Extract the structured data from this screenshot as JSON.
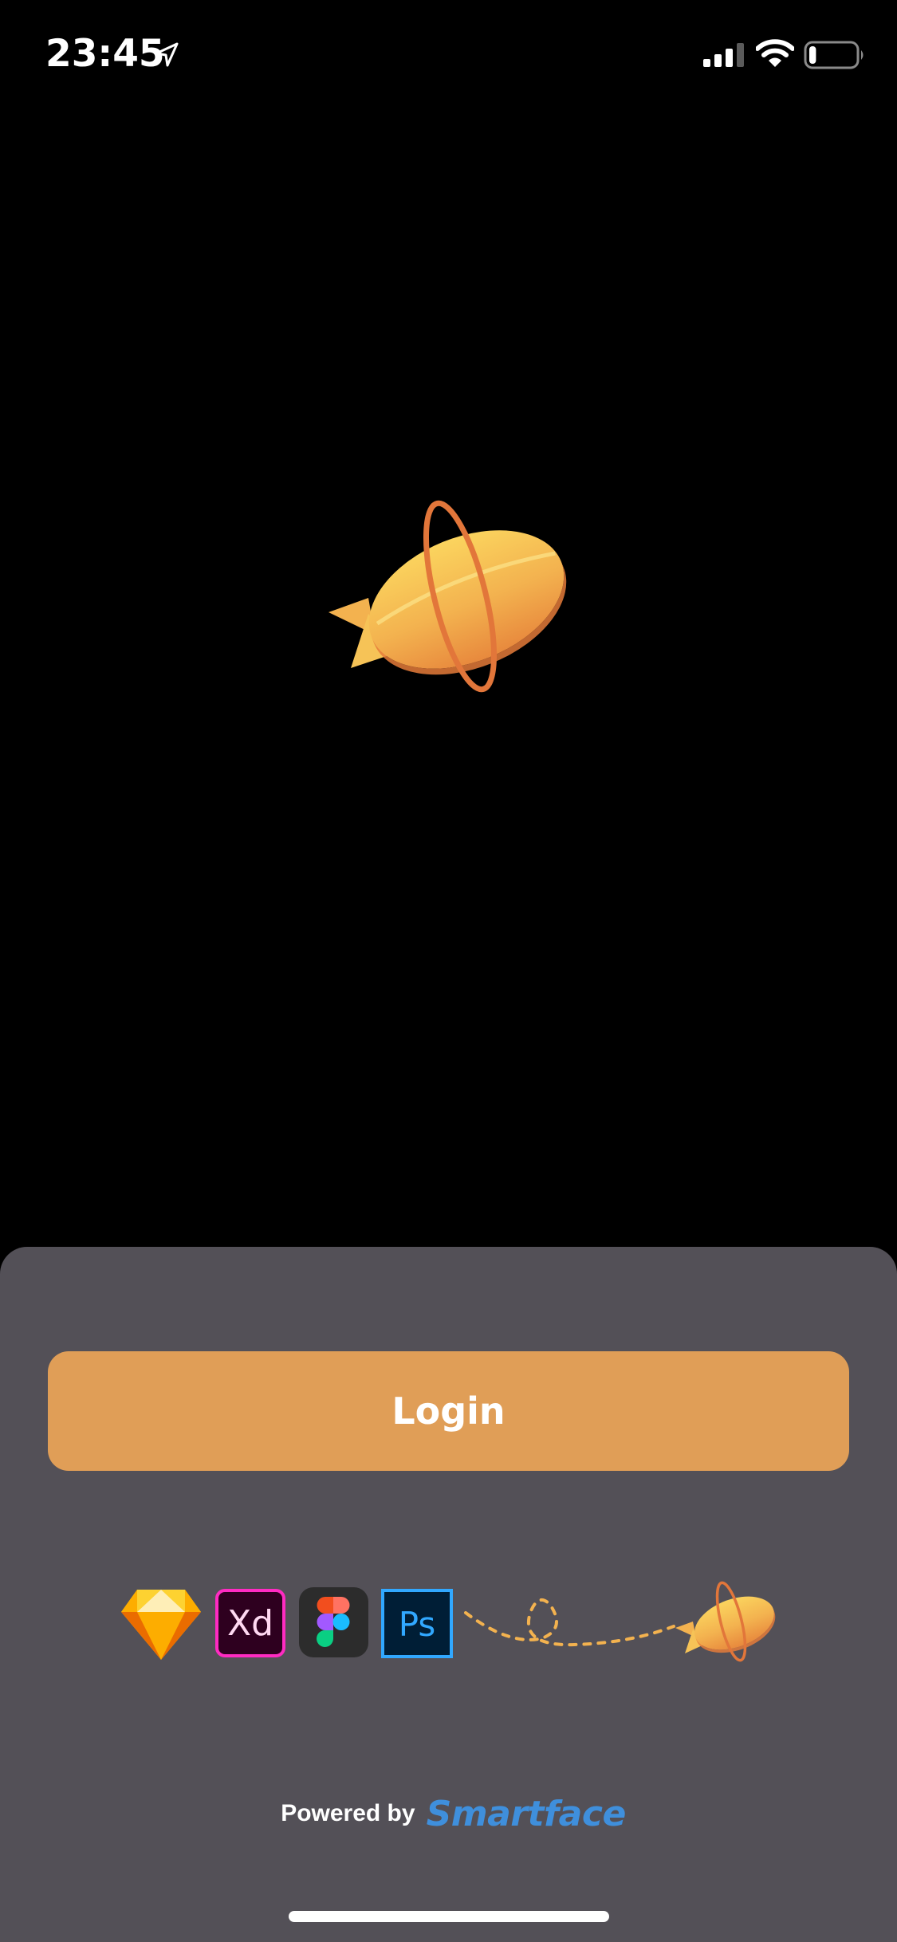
{
  "status_bar": {
    "time": "23:45",
    "icons": [
      "location-arrow-icon",
      "cellular-signal-icon",
      "wifi-icon",
      "battery-icon"
    ],
    "battery_level": 0.15
  },
  "hero": {
    "logo": "zeppelin-logo-icon"
  },
  "sheet": {
    "login_label": "Login",
    "tool_icons": [
      "sketch-icon",
      "adobe-xd-icon",
      "figma-icon",
      "photoshop-icon",
      "flight-path-icon",
      "zeppelin-icon"
    ],
    "tool_labels": {
      "xd": "Xd",
      "ps": "Ps"
    },
    "powered_by": "Powered by",
    "brand": "Smartface"
  },
  "colors": {
    "background": "#000000",
    "sheet": "#535057",
    "button": "#e09e57",
    "brand": "#3f8fdc",
    "zeppelin_body": "#f5b951",
    "zeppelin_ring": "#e2763a"
  }
}
